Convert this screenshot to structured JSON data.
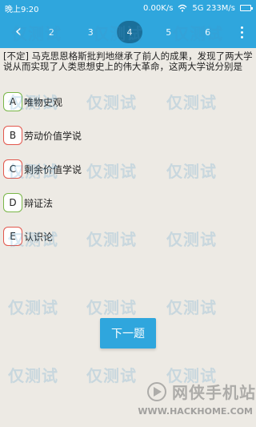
{
  "status_bar": {
    "time": "晚上9:20",
    "speed": "0.00K/s",
    "network": "5G 233M/s"
  },
  "tabs": [
    "2",
    "3",
    "4",
    "5",
    "6"
  ],
  "active_tab_index": 2,
  "question": {
    "text": "[不定] 马克思恩格斯批判地继承了前人的成果，发现了两大学说从而实现了人类思想史上的伟大革命，这两大学说分别是"
  },
  "options": [
    {
      "letter": "A",
      "text": "唯物史观",
      "border": "green"
    },
    {
      "letter": "B",
      "text": "劳动价值学说",
      "border": "red"
    },
    {
      "letter": "C",
      "text": "剩余价值学说",
      "border": "red"
    },
    {
      "letter": "D",
      "text": "辩证法",
      "border": "green"
    },
    {
      "letter": "E",
      "text": "认识论",
      "border": "red"
    }
  ],
  "next_button": {
    "label": "下一题"
  },
  "watermark_text": "仅测试",
  "brand": {
    "name": "网侠手机站",
    "url": "WWW.HACKHOME.COM"
  },
  "colors": {
    "accent": "#2fa6dd",
    "active_tab": "#1a6f9a",
    "option_green": "#7ab648",
    "option_red": "#e2574c",
    "background": "#edeae4"
  }
}
